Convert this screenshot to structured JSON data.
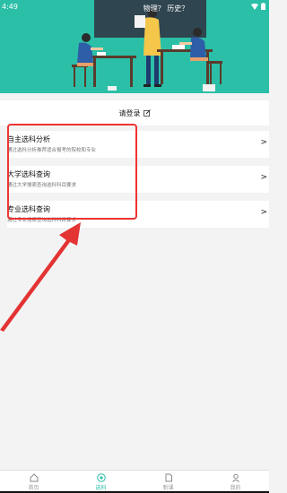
{
  "status": {
    "time": "4:49"
  },
  "hero": {
    "chalkboard_text": "物理？  历史？"
  },
  "login": {
    "label": "请登录"
  },
  "cards": [
    {
      "title": "自主选科分析",
      "subtitle": "通过选科分析推荐适合报考的院校和专业"
    },
    {
      "title": "大学选科查询",
      "subtitle": "通过大学搜索查询选科科目要求"
    },
    {
      "title": "专业选科查询",
      "subtitle": "通过专业搜索查询选科科目要求"
    }
  ],
  "tabs": [
    {
      "label": "首页",
      "icon": "home-icon",
      "active": false
    },
    {
      "label": "选科",
      "icon": "compass-icon",
      "active": true
    },
    {
      "label": "新课",
      "icon": "document-icon",
      "active": false
    },
    {
      "label": "我的",
      "icon": "person-icon",
      "active": false
    }
  ],
  "colors": {
    "accent": "#2bbfa7",
    "annotation": "#e33333"
  }
}
